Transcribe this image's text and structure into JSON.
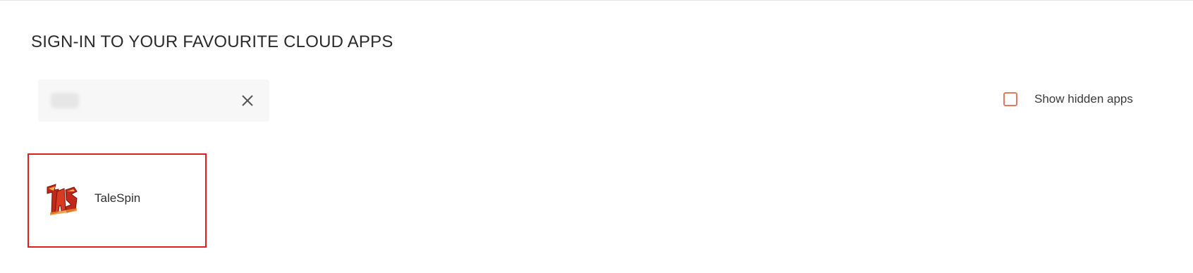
{
  "header": {
    "title": "SIGN-IN TO YOUR FAVOURITE CLOUD APPS"
  },
  "search": {
    "value": "",
    "clear_icon": "close-icon"
  },
  "filters": {
    "show_hidden_label": "Show hidden apps",
    "show_hidden_checked": false,
    "checkbox_color": "#e07b62"
  },
  "apps": [
    {
      "name": "TaleSpin",
      "logo_icon": "talespin-logo",
      "highlight_color": "#e01e1e"
    }
  ]
}
